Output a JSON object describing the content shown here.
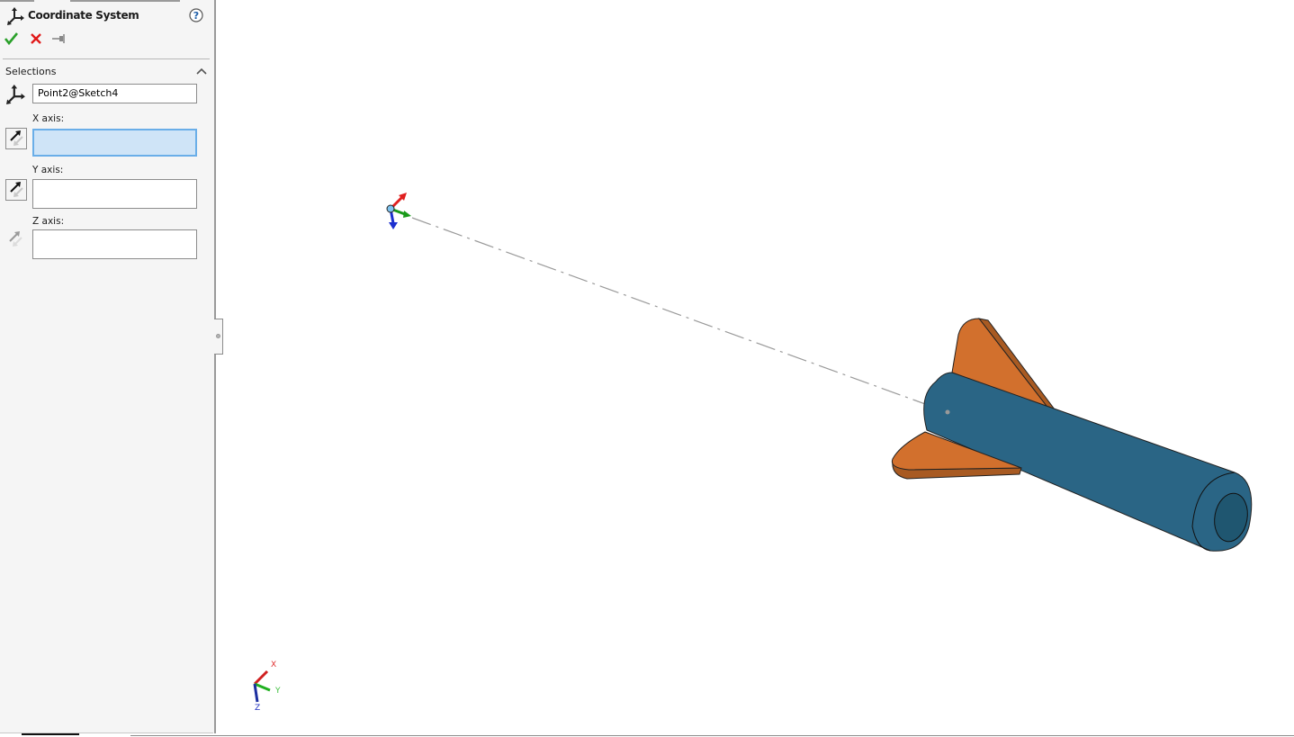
{
  "property_manager": {
    "title": "Coordinate System",
    "icons": {
      "title": "coordinate-system-icon",
      "help": "help-icon",
      "ok": "checkmark-icon",
      "cancel": "close-icon",
      "pin": "pushpin-icon",
      "collapse": "chevron-up-icon"
    },
    "section": {
      "title": "Selections",
      "origin_value": "Point2@Sketch4",
      "x_axis_label": "X axis:",
      "x_axis_value": "",
      "y_axis_label": "Y axis:",
      "y_axis_value": "",
      "z_axis_label": "Z axis:",
      "z_axis_value": ""
    }
  },
  "viewport": {
    "triad_labels": {
      "x": "X",
      "y": "Y",
      "z": "Z"
    },
    "colors": {
      "rocket_body": "#2a6585",
      "rocket_fin": "#d2702d",
      "fin_edge": "#a85a22",
      "axis_x": "#e02020",
      "axis_y": "#1a9a1a",
      "axis_z": "#1c2fcf",
      "origin_point": "#7ec3ef",
      "centerline": "#9a9a9a"
    }
  },
  "colors": {
    "accent_active_field": "#cfe4f7",
    "ok_green": "#2aa02a",
    "cancel_red": "#e01818",
    "help_blue": "#1e5ea8"
  }
}
